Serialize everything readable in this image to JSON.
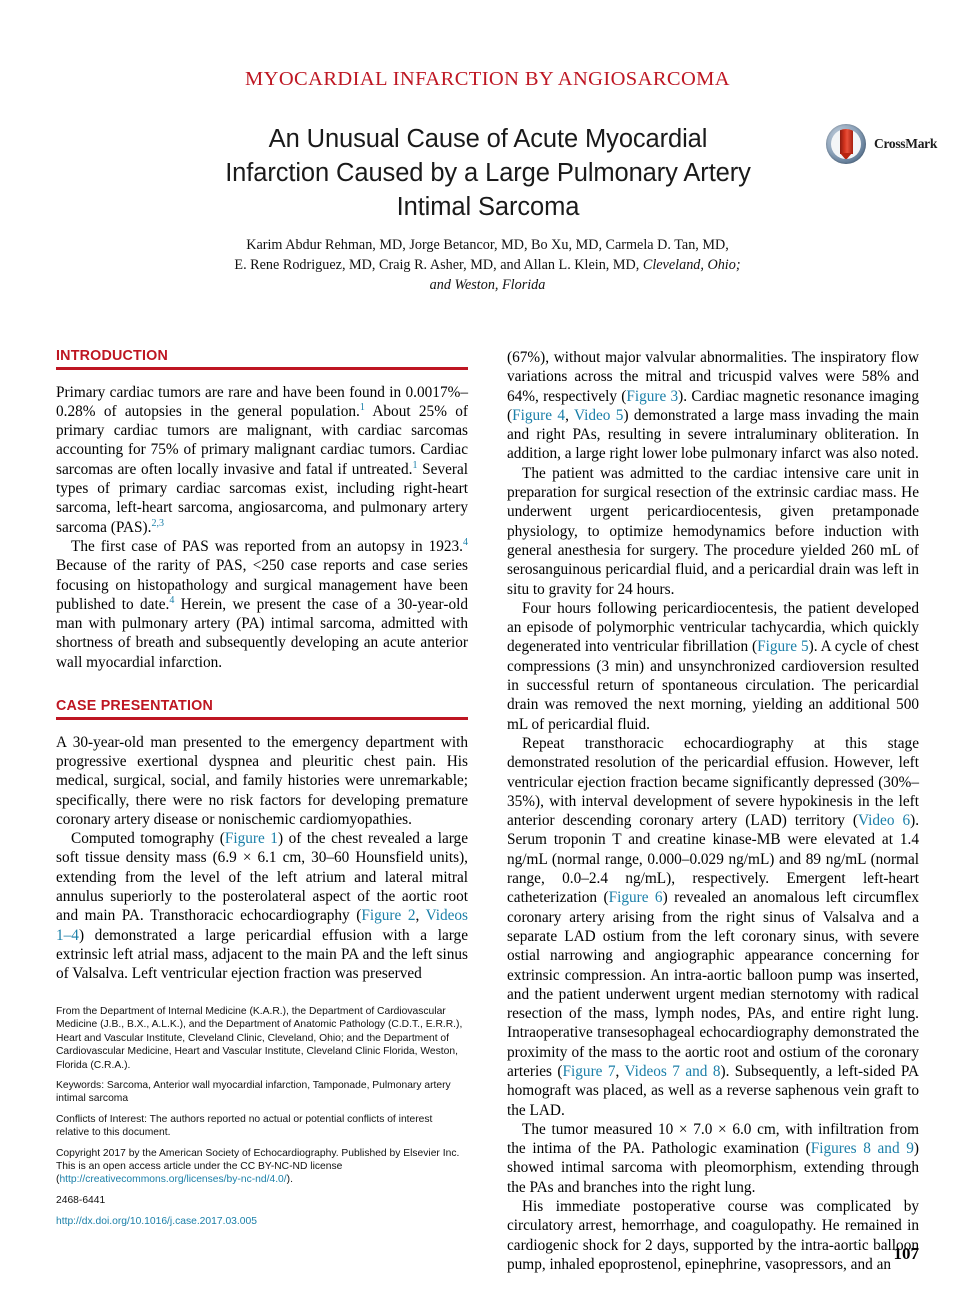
{
  "running_head": "MYOCARDIAL INFARCTION BY ANGIOSARCOMA",
  "colors": {
    "accent_red": "#be1622",
    "link_teal": "#1a7fa8",
    "text": "#000000"
  },
  "title": {
    "line1": "An Unusual Cause of Acute Myocardial",
    "line2": "Infarction Caused by a Large Pulmonary Artery",
    "line3": "Intimal Sarcoma"
  },
  "authors": {
    "line1": "Karim Abdur Rehman, MD, Jorge Betancor, MD, Bo Xu, MD, Carmela D. Tan, MD,",
    "line2_a": "E. Rene Rodriguez, MD, Craig R. Asher, MD, and Allan L. Klein, MD, ",
    "line2_loc": "Cleveland, Ohio;",
    "line3_loc": "and Weston, Florida"
  },
  "crossmark": {
    "label": "CrossMark",
    "icon": "crossmark-logo-icon"
  },
  "sections": {
    "introduction": {
      "heading": "INTRODUCTION",
      "p1_a": "Primary cardiac tumors are rare and have been found in 0.0017%–0.28% of autopsies in the general population.",
      "p1_sup1": "1",
      "p1_b": " About 25% of primary cardiac tumors are malignant, with cardiac sarcomas accounting for 75% of primary malignant cardiac tumors. Cardiac sarcomas are often locally invasive and fatal if untreated.",
      "p1_sup2": "1",
      "p1_c": " Several types of primary cardiac sarcomas exist, including right-heart sarcoma, left-heart sarcoma, angiosarcoma, and pulmonary artery sarcoma (PAS).",
      "p1_sup3": "2,3",
      "p2_a": "The first case of PAS was reported from an autopsy in 1923.",
      "p2_sup1": "4",
      "p2_b": " Because of the rarity of PAS, <250 case reports and case series focusing on histopathology and surgical management have been published to date.",
      "p2_sup2": "4",
      "p2_c": " Herein, we present the case of a 30-year-old man with pulmonary artery (PA) intimal sarcoma, admitted with shortness of breath and subsequently developing an acute anterior wall myocardial infarction."
    },
    "case_presentation": {
      "heading": "CASE PRESENTATION",
      "p1": "A 30-year-old man presented to the emergency department with progressive exertional dyspnea and pleuritic chest pain. His medical, surgical, social, and family histories were unremarkable; specifically, there were no risk factors for developing premature coronary artery disease or nonischemic cardiomyopathies.",
      "p2_a": "Computed tomography (",
      "p2_link1": "Figure 1",
      "p2_b": ") of the chest revealed a large soft tissue density mass (6.9 × 6.1 cm, 30–60 Hounsfield units), extending from the level of the left atrium and lateral mitral annulus superiorly to the posterolateral aspect of the aortic root and main PA. Transthoracic echocardiography (",
      "p2_link2": "Figure 2",
      "p2_c": ", ",
      "p2_link3": "Videos 1–4",
      "p2_d": ") demonstrated a large pericardial effusion with a large extrinsic left atrial mass, adjacent to the main PA and the left sinus of Valsalva. Left ventricular ejection fraction was preserved"
    }
  },
  "right_column": {
    "p1_a": "(67%), without major valvular abnormalities. The inspiratory flow variations across the mitral and tricuspid valves were 58% and 64%, respectively (",
    "p1_link1": "Figure 3",
    "p1_b": "). Cardiac magnetic resonance imaging (",
    "p1_link2": "Figure 4",
    "p1_c": ", ",
    "p1_link3": "Video 5",
    "p1_d": ") demonstrated a large mass invading the main and right PAs, resulting in severe intraluminary obliteration. In addition, a large right lower lobe pulmonary infarct was also noted.",
    "p2": "The patient was admitted to the cardiac intensive care unit in preparation for surgical resection of the extrinsic cardiac mass. He underwent urgent pericardiocentesis, given pretamponade physiology, to optimize hemodynamics before induction with general anesthesia for surgery. The procedure yielded 260 mL of serosanguinous pericardial fluid, and a pericardial drain was left in situ to gravity for 24 hours.",
    "p3_a": "Four hours following pericardiocentesis, the patient developed an episode of polymorphic ventricular tachycardia, which quickly degenerated into ventricular fibrillation (",
    "p3_link1": "Figure 5",
    "p3_b": "). A cycle of chest compressions (3 min) and unsynchronized cardioversion resulted in successful return of spontaneous circulation. The pericardial drain was removed the next morning, yielding an additional 500 mL of pericardial fluid.",
    "p4_a": "Repeat transthoracic echocardiography at this stage demonstrated resolution of the pericardial effusion. However, left ventricular ejection fraction became significantly depressed (30%–35%), with interval development of severe hypokinesis in the left anterior descending coronary artery (LAD) territory (",
    "p4_link1": "Video 6",
    "p4_b": "). Serum troponin T and creatine kinase-MB were elevated at 1.4 ng/mL (normal range, 0.000–0.029 ng/mL) and 89 ng/mL (normal range, 0.0–2.4 ng/mL), respectively. Emergent left-heart catheterization (",
    "p4_link2": "Figure 6",
    "p4_c": ") revealed an anomalous left circumflex coronary artery arising from the right sinus of Valsalva and a separate LAD ostium from the left coronary sinus, with severe ostial narrowing and angiographic appearance concerning for extrinsic compression. An intra-aortic balloon pump was inserted, and the patient underwent urgent median sternotomy with radical resection of the mass, lymph nodes, PAs, and entire right lung. Intraoperative transesophageal echocardiography demonstrated the proximity of the mass to the aortic root and ostium of the coronary arteries (",
    "p4_link3": "Figure 7",
    "p4_d": ", ",
    "p4_link4": "Videos 7 and 8",
    "p4_e": "). Subsequently, a left-sided PA homograft was placed, as well as a reverse saphenous vein graft to the LAD.",
    "p5_a": "The tumor measured 10 × 7.0 × 6.0 cm, with infiltration from the intima of the PA. Pathologic examination (",
    "p5_link1": "Figures 8 and 9",
    "p5_b": ") showed intimal sarcoma with pleomorphism, extending through the PAs and branches into the right lung.",
    "p6": "His immediate postoperative course was complicated by circulatory arrest, hemorrhage, and coagulopathy. He remained in cardiogenic shock for 2 days, supported by the intra-aortic balloon pump, inhaled epoprostenol, epinephrine, vasopressors, and an"
  },
  "footnotes": {
    "affiliation": "From the Department of Internal Medicine (K.A.R.), the Department of Cardiovascular Medicine (J.B., B.X., A.L.K.), and the Department of Anatomic Pathology (C.D.T., E.R.R.), Heart and Vascular Institute, Cleveland Clinic, Cleveland, Ohio; and the Department of Cardiovascular Medicine, Heart and Vascular Institute, Cleveland Clinic Florida, Weston, Florida (C.R.A.).",
    "keywords": "Keywords: Sarcoma, Anterior wall myocardial infarction, Tamponade, Pulmonary artery intimal sarcoma",
    "conflicts": "Conflicts of Interest: The authors reported no actual or potential conflicts of interest relative to this document.",
    "copyright_a": "Copyright 2017 by the American Society of Echocardiography. Published by Elsevier Inc. This is an open access article under the CC BY-NC-ND license (",
    "copyright_link": "http://creativecommons.org/licenses/by-nc-nd/4.0/",
    "copyright_b": ").",
    "issn": "2468-6441",
    "doi": "http://dx.doi.org/10.1016/j.case.2017.03.005"
  },
  "page_number": "107"
}
